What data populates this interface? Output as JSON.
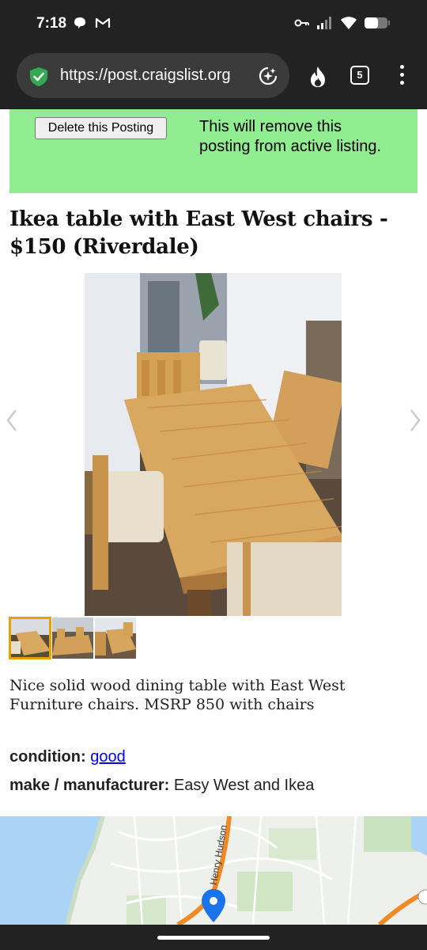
{
  "status_bar": {
    "time": "7:18",
    "left_icons": [
      "chat-bubble-icon",
      "gmail-icon"
    ],
    "right_icons": [
      "key-icon",
      "signal-icon",
      "wifi-icon",
      "battery-icon"
    ]
  },
  "browser": {
    "url": "https://post.craigslist.org",
    "tab_count": "5",
    "icons": [
      "security-shield-icon",
      "lens-search-icon",
      "fire-icon",
      "tabs-icon",
      "overflow-menu-icon"
    ]
  },
  "notice": {
    "button_label": "Delete this Posting",
    "text": "This will remove this posting from active listing.",
    "bg_color": "#90ee90"
  },
  "posting": {
    "title": "Ikea table with East West chairs - $150 (Riverdale)",
    "description": "Nice solid wood dining table with East West Furniture chairs. MSRP 850 with chairs",
    "image_count": 3,
    "selected_thumb": 1
  },
  "attributes": {
    "condition_label": "condition:",
    "condition_value": "good",
    "make_label": "make / manufacturer:",
    "make_value": "Easy West and Ikea"
  },
  "map": {
    "road_label": "Henry Hudson",
    "marker": "location-pin-icon"
  },
  "colors": {
    "link": "#0000ee",
    "thumb_highlight": "#e8a200",
    "map_route": "#f08a24"
  }
}
